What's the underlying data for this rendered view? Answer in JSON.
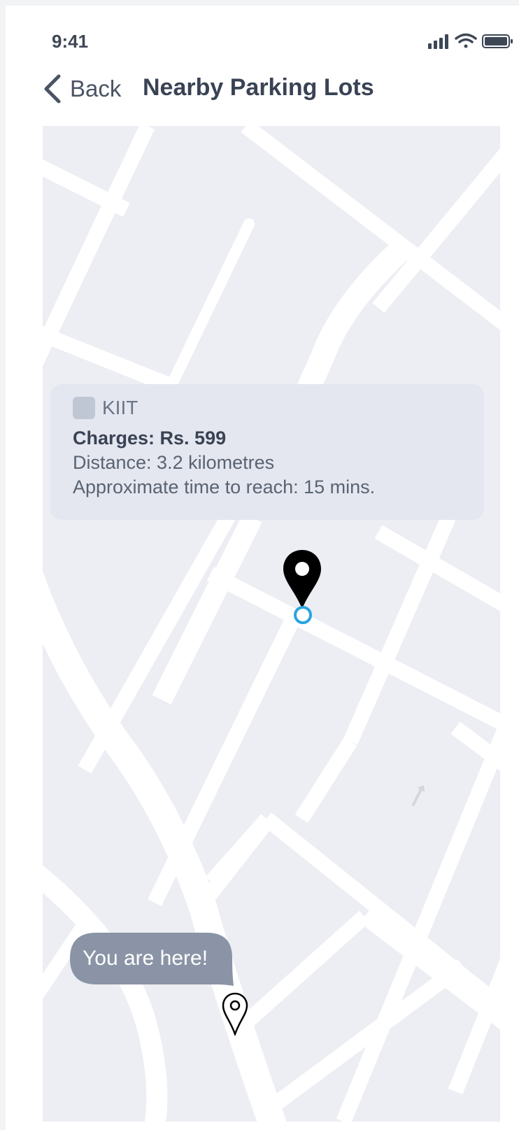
{
  "status_bar": {
    "time": "9:41",
    "icons": [
      "signal-icon",
      "wifi-icon",
      "battery-icon"
    ]
  },
  "header": {
    "back_label": "Back",
    "title": "Nearby Parking Lots"
  },
  "parking_lot": {
    "name": "KIIT",
    "charges": "Charges: Rs. 599",
    "distance": "Distance: 3.2 kilometres",
    "eta": "Approximate time to reach: 15 mins."
  },
  "user_location": {
    "bubble_text": "You are here!"
  },
  "colors": {
    "map_background": "#eceef3",
    "road": "#ffffff",
    "card": "#e4e7ef",
    "bubble": "#8a94a6",
    "accent_blue": "#2aa3e0",
    "pin": "#000000"
  }
}
